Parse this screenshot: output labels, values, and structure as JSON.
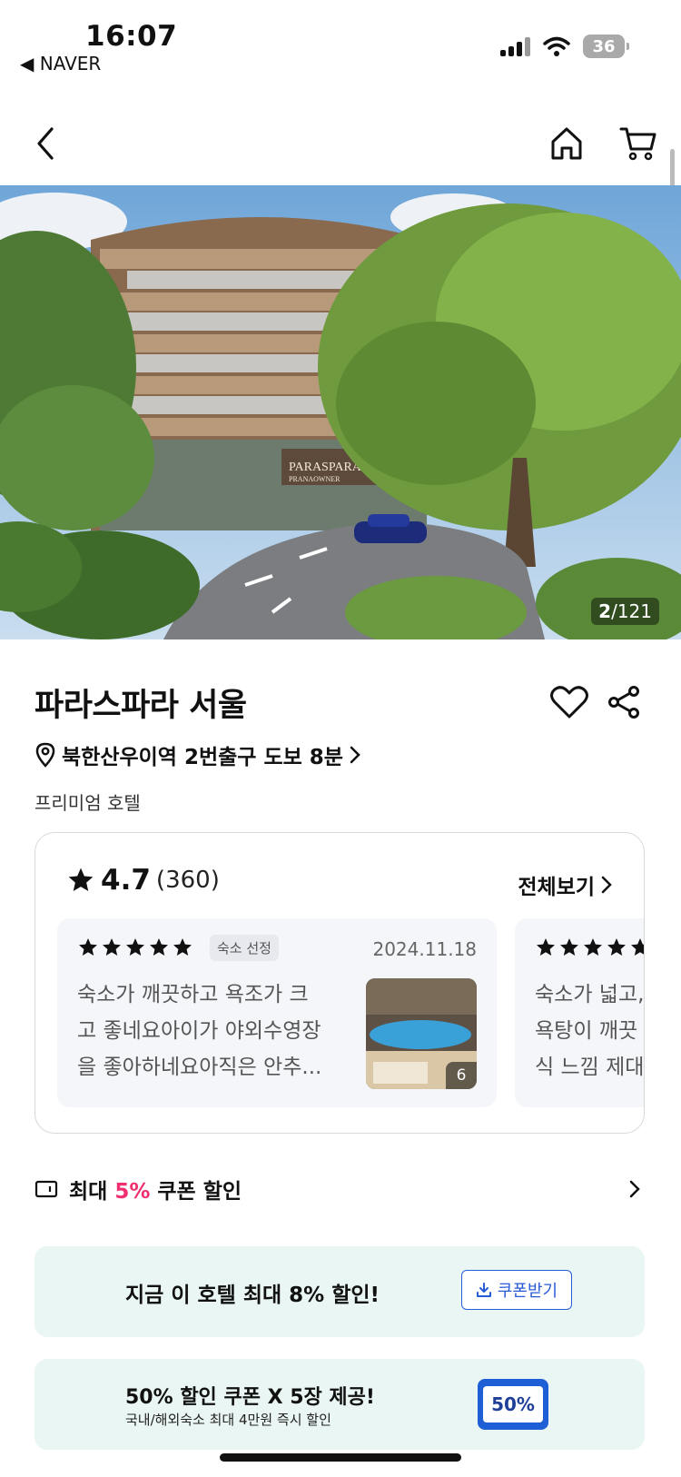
{
  "status_bar": {
    "time": "16:07",
    "back_app": "◀ NAVER",
    "battery": "36"
  },
  "nav": {
    "back_icon": "chevron-left-icon",
    "home_icon": "home-icon",
    "cart_icon": "cart-icon"
  },
  "hero": {
    "sign_text": "PARASPARA",
    "sign_sub": "PRANAOWNER",
    "counter_current": "2",
    "counter_total": "/121"
  },
  "hotel": {
    "name": "파라스파라 서울",
    "location": "북한산우이역 2번출구 도보 8분",
    "category": "프리미엄 호텔"
  },
  "reviews": {
    "rating": "4.7",
    "count": "(360)",
    "view_all": "전체보기",
    "items": [
      {
        "stars": 5,
        "badge": "숙소 선정",
        "date": "2024.11.18",
        "text_lines": [
          "숙소가 깨끗하고 욕조가 크",
          "고 좋네요아이가 야외수영장",
          "을 좋아하네요아직은 안추..."
        ],
        "photo_count": "6"
      },
      {
        "stars": 5,
        "text_lines": [
          "숙소가 넓고,",
          "욕탕이 깨끗",
          "식 느낌 제대"
        ]
      }
    ]
  },
  "coupon_row": {
    "prefix": "최대 ",
    "percent": "5%",
    "suffix": " 쿠폰 할인"
  },
  "banner1": {
    "text": "지금 이 호텔 최대 8% 할인!",
    "button": "쿠폰받기"
  },
  "banner2": {
    "title": "50% 할인 쿠폰 X 5장 제공!",
    "subtitle": "국내/해외숙소 최대 4만원 즉시 할인",
    "badge": "50%"
  },
  "colors": {
    "accent_pink": "#ef2f6e",
    "accent_blue": "#2a5bd7",
    "banner_bg": "#eaf6f3"
  }
}
